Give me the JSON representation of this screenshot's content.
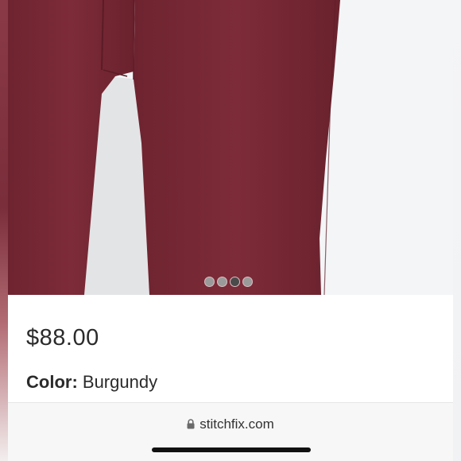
{
  "product": {
    "price": "$88.00",
    "color_label": "Color:",
    "color_value": "Burgundy"
  },
  "carousel": {
    "total": 4,
    "active_index": 3
  },
  "browser": {
    "url": "stitchfix.com"
  },
  "colors": {
    "pants": "#7b2a36",
    "background": "#f4f5f7"
  },
  "icons": [
    "lock-icon"
  ]
}
